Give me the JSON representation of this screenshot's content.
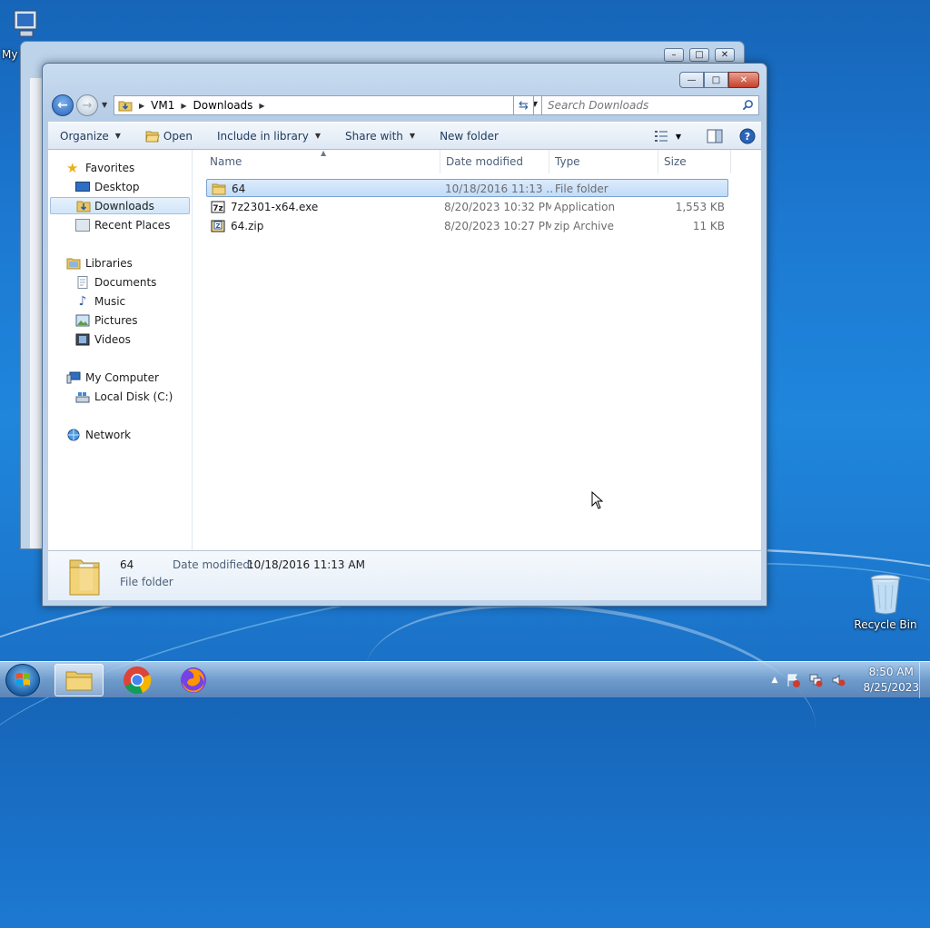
{
  "desktop": {
    "icons": [
      {
        "name": "my-computer",
        "label": "My"
      },
      {
        "name": "recycle-bin",
        "label": "Recycle Bin"
      }
    ]
  },
  "window": {
    "address": {
      "crumbs": [
        "VM1",
        "Downloads"
      ],
      "search_placeholder": "Search Downloads"
    },
    "toolbar": {
      "organize": "Organize",
      "open": "Open",
      "include_in_library": "Include in library",
      "share_with": "Share with",
      "new_folder": "New folder"
    },
    "nav": {
      "favorites": "Favorites",
      "desktop": "Desktop",
      "downloads": "Downloads",
      "recent_places": "Recent Places",
      "libraries": "Libraries",
      "documents": "Documents",
      "music": "Music",
      "pictures": "Pictures",
      "videos": "Videos",
      "my_computer": "My Computer",
      "local_disk": "Local Disk (C:)",
      "network": "Network"
    },
    "columns": {
      "name": "Name",
      "date_modified": "Date modified",
      "type": "Type",
      "size": "Size"
    },
    "files": [
      {
        "name": "64",
        "date": "10/18/2016 11:13 ...",
        "type": "File folder",
        "size": "",
        "selected": true
      },
      {
        "name": "7z2301-x64.exe",
        "date": "8/20/2023 10:32 PM",
        "type": "Application",
        "size": "1,553 KB",
        "selected": false
      },
      {
        "name": "64.zip",
        "date": "8/20/2023 10:27 PM",
        "type": "zip Archive",
        "size": "11 KB",
        "selected": false
      }
    ],
    "details": {
      "name": "64",
      "type": "File folder",
      "date_label": "Date modified:",
      "date_value": "10/18/2016 11:13 AM"
    }
  },
  "taskbar": {
    "time": "8:50 AM",
    "date": "8/25/2023"
  },
  "colors": {
    "selection": "#c1dcf9",
    "accent": "#1e395b",
    "desktop": "#1d7ad3"
  }
}
